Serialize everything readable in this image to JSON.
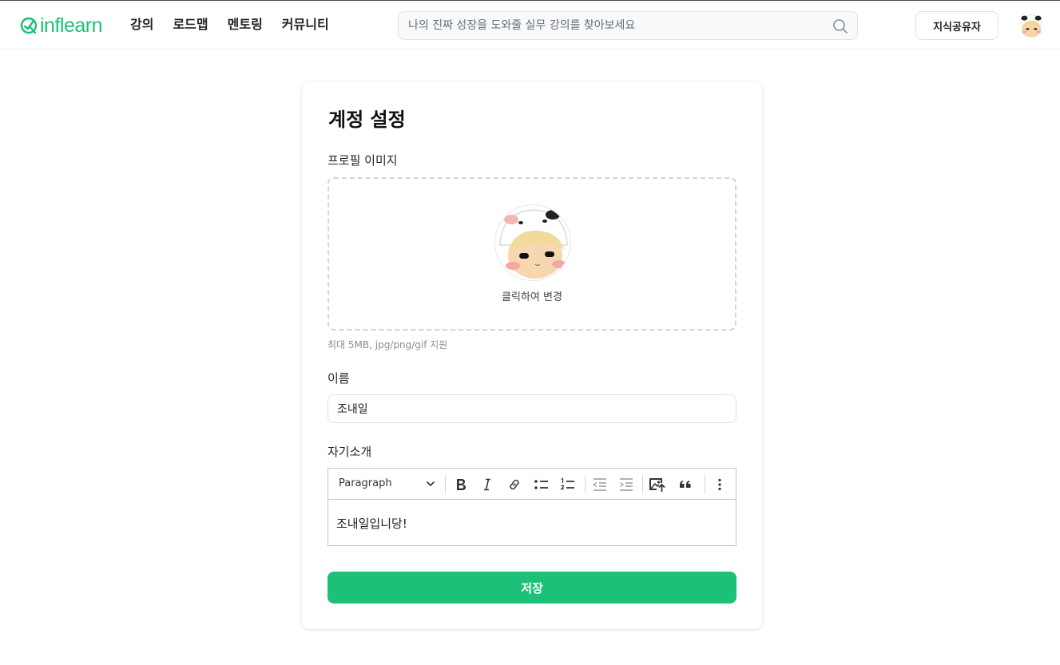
{
  "header": {
    "logo_text": "inflearn",
    "nav": [
      "강의",
      "로드맵",
      "멘토링",
      "커뮤니티"
    ],
    "search_placeholder": "나의 진짜 성장을 도와줄 실무 강의를 찾아보세요",
    "share_button": "지식공유자"
  },
  "page": {
    "title": "계정 설정",
    "profile_label": "프로필 이미지",
    "profile_change_text": "클릭하여 변경",
    "profile_hint": "최대 5MB, jpg/png/gif 지원",
    "name_label": "이름",
    "name_value": "조내일",
    "bio_label": "자기소개",
    "editor_paragraph": "Paragraph",
    "bio_value": "조내일입니당!",
    "save_button": "저장"
  },
  "colors": {
    "brand": "#1dc078"
  }
}
